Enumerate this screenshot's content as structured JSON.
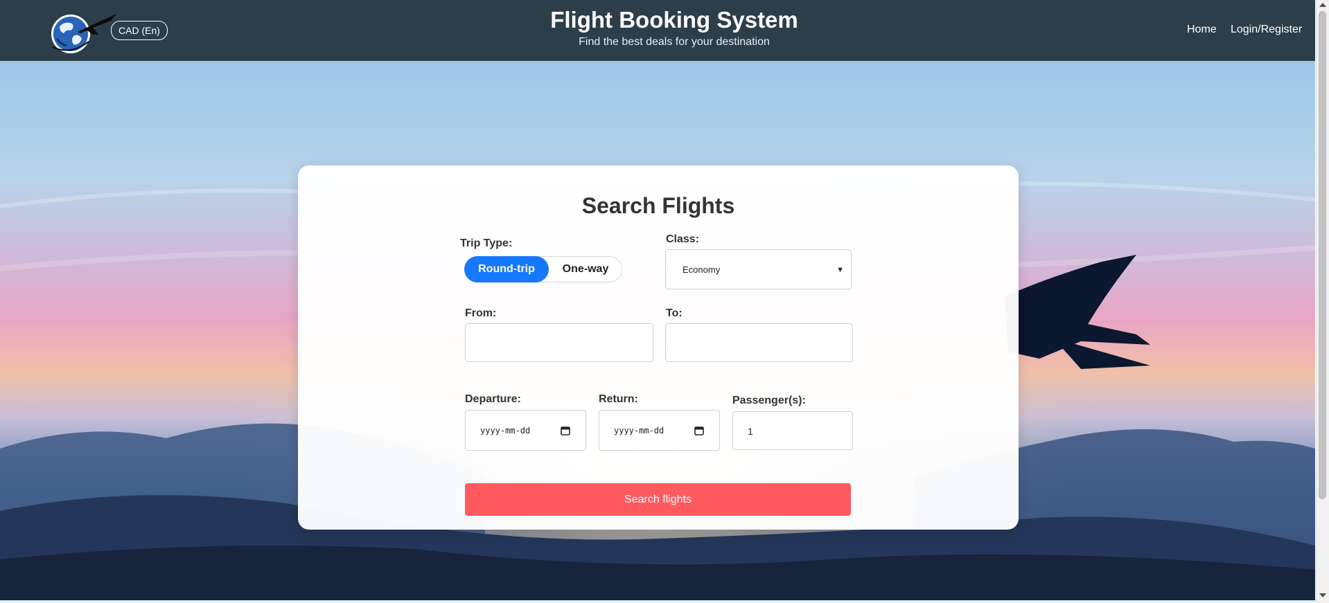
{
  "header": {
    "title": "Flight Booking System",
    "subtitle": "Find the best deals for your destination",
    "currency_label": "CAD (En)",
    "nav": {
      "home": "Home",
      "login": "Login/Register"
    }
  },
  "search": {
    "heading": "Search Flights",
    "trip_type": {
      "label": "Trip Type:",
      "options": [
        "Round-trip",
        "One-way"
      ],
      "selected": "Round-trip"
    },
    "class": {
      "label": "Class:",
      "value": "Economy"
    },
    "from": {
      "label": "From:",
      "value": ""
    },
    "to": {
      "label": "To:",
      "value": ""
    },
    "departure": {
      "label": "Departure:",
      "placeholder": "yyyy-mm-dd"
    },
    "return": {
      "label": "Return:",
      "placeholder": "yyyy-mm-dd"
    },
    "passengers": {
      "label": "Passenger(s):",
      "value": "1"
    },
    "submit_label": "Search flights"
  },
  "colors": {
    "header_bg": "#2c3e4a",
    "accent_blue": "#1677ff",
    "search_button": "#ff5a5f"
  }
}
